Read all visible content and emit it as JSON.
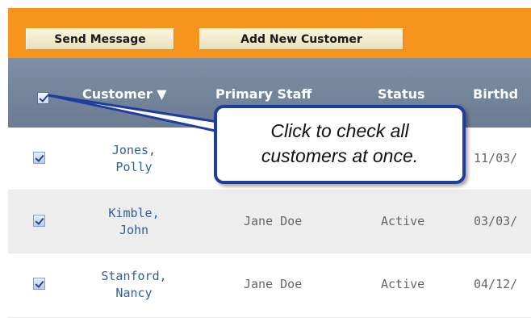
{
  "toolbar": {
    "send_message_label": "Send Message",
    "add_customer_label": "Add New Customer"
  },
  "table": {
    "select_all_checked": true,
    "columns": [
      {
        "label": "Customer ▼",
        "sorted": "desc"
      },
      {
        "label": "Primary Staff"
      },
      {
        "label": "Status"
      },
      {
        "label": "Birthd"
      }
    ],
    "rows": [
      {
        "checked": true,
        "name_line1": "Jones,",
        "name_line2": "Polly",
        "staff": "",
        "status": "",
        "birthday": "11/03/"
      },
      {
        "checked": true,
        "name_line1": "Kimble,",
        "name_line2": "John",
        "staff": "Jane Doe",
        "status": "Active",
        "birthday": "03/03/"
      },
      {
        "checked": true,
        "name_line1": "Stanford,",
        "name_line2": "Nancy",
        "staff": "Jane Doe",
        "status": "Active",
        "birthday": "04/12/"
      }
    ]
  },
  "callout": {
    "line1": "Click to check all",
    "line2": "customers at once."
  },
  "colors": {
    "toolbar_bg": "#f7941e",
    "header_bg": "#75869d",
    "link": "#2f5f96",
    "callout_border": "#1f3da0"
  }
}
